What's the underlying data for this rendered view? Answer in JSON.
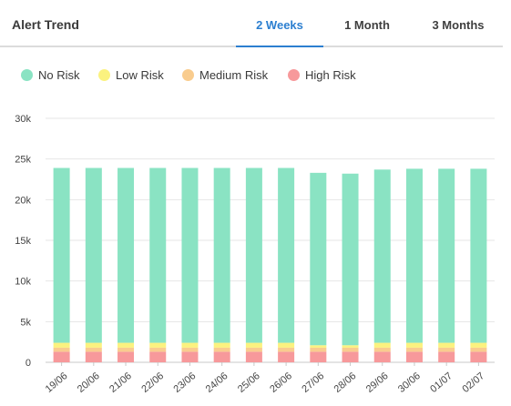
{
  "header": {
    "title": "Alert Trend",
    "tabs": [
      {
        "label": "2 Weeks",
        "active": true
      },
      {
        "label": "1 Month",
        "active": false
      },
      {
        "label": "3 Months",
        "active": false
      }
    ],
    "accent_color": "#2c7fd0"
  },
  "chart_data": {
    "type": "bar",
    "stacked": true,
    "categories": [
      "19/06",
      "20/06",
      "21/06",
      "22/06",
      "23/06",
      "24/06",
      "25/06",
      "26/06",
      "27/06",
      "28/06",
      "29/06",
      "30/06",
      "01/07",
      "02/07"
    ],
    "series": [
      {
        "name": "High Risk",
        "color": "#f7999b",
        "values": [
          1300,
          1300,
          1300,
          1300,
          1300,
          1300,
          1300,
          1300,
          1300,
          1300,
          1300,
          1300,
          1300,
          1300
        ]
      },
      {
        "name": "Medium Risk",
        "color": "#f9cc8e",
        "values": [
          500,
          500,
          500,
          500,
          500,
          500,
          500,
          500,
          500,
          500,
          500,
          500,
          500,
          500
        ]
      },
      {
        "name": "Low Risk",
        "color": "#fbf27f",
        "values": [
          600,
          600,
          600,
          600,
          600,
          600,
          600,
          600,
          300,
          300,
          600,
          600,
          600,
          600
        ]
      },
      {
        "name": "No Risk",
        "color": "#8ae3c3",
        "values": [
          21500,
          21500,
          21500,
          21500,
          21500,
          21500,
          21500,
          21500,
          21200,
          21100,
          21300,
          21400,
          21400,
          21400
        ]
      }
    ],
    "legend_order": [
      "No Risk",
      "Low Risk",
      "Medium Risk",
      "High Risk"
    ],
    "ylim": [
      0,
      30000
    ],
    "yticks": [
      0,
      5000,
      10000,
      15000,
      20000,
      25000,
      30000
    ],
    "ytick_labels": [
      "0",
      "5k",
      "10k",
      "15k",
      "20k",
      "25k",
      "30k"
    ],
    "grid": true,
    "legend_position": "top-left",
    "title": "",
    "xlabel": "",
    "ylabel": ""
  }
}
